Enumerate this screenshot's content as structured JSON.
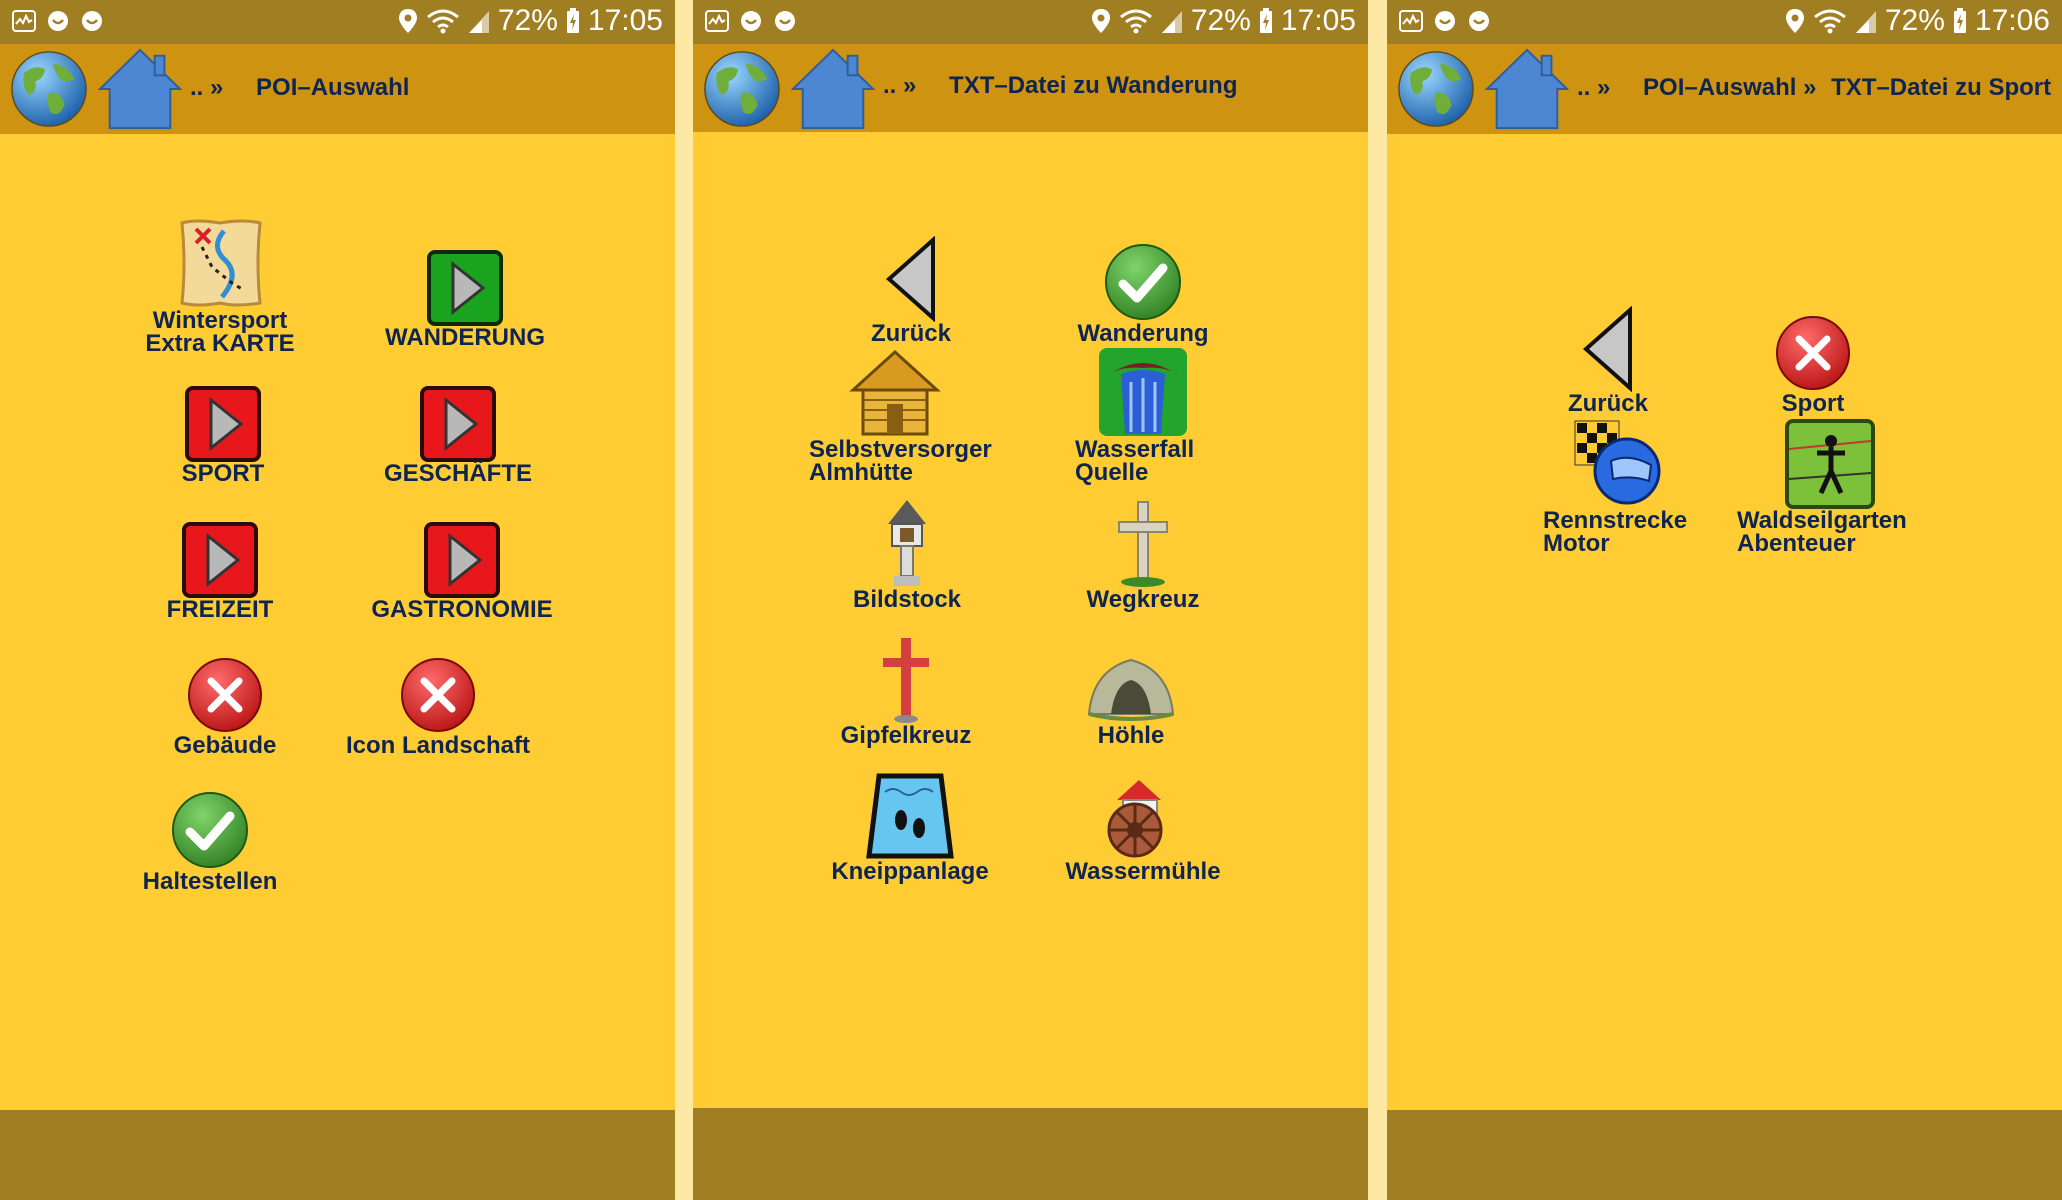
{
  "status": {
    "battery": "72%",
    "times": [
      "17:05",
      "17:05",
      "17:06"
    ]
  },
  "colors": {
    "background": "#ffcc33",
    "header": "#cf9312",
    "statusbar": "#a07e22",
    "text": "#0e2550"
  },
  "screens": [
    {
      "breadcrumb_prefix": ".. »",
      "title": "POI–Auswahl",
      "items": [
        {
          "label1": "Wintersport",
          "label2": "Extra KARTE",
          "icon": "map-icon"
        },
        {
          "label1": "WANDERUNG",
          "label2": "",
          "icon": "green-play-icon"
        },
        {
          "label1": "SPORT",
          "label2": "",
          "icon": "red-play-icon"
        },
        {
          "label1": "GESCHÄFTE",
          "label2": "",
          "icon": "red-play-icon"
        },
        {
          "label1": "FREIZEIT",
          "label2": "",
          "icon": "red-play-icon"
        },
        {
          "label1": "GASTRONOMIE",
          "label2": "",
          "icon": "red-play-icon"
        },
        {
          "label1": "Gebäude",
          "label2": "",
          "icon": "red-x-icon"
        },
        {
          "label1": "Icon Landschaft",
          "label2": "",
          "icon": "red-x-icon"
        },
        {
          "label1": "Haltestellen",
          "label2": "",
          "icon": "green-check-icon"
        }
      ]
    },
    {
      "breadcrumb_prefix": ".. »",
      "title": "TXT–Datei zu Wanderung",
      "items": [
        {
          "label1": "Zurück",
          "label2": "",
          "icon": "back-triangle-icon"
        },
        {
          "label1": "Wanderung",
          "label2": "",
          "icon": "green-check-icon"
        },
        {
          "label1": "Selbstversorger",
          "label2": "Almhütte",
          "icon": "log-cabin-icon"
        },
        {
          "label1": "Wasserfall",
          "label2": "Quelle",
          "icon": "waterfall-icon"
        },
        {
          "label1": "Bildstock",
          "label2": "",
          "icon": "wayside-shrine-icon"
        },
        {
          "label1": "Wegkreuz",
          "label2": "",
          "icon": "wayside-cross-icon"
        },
        {
          "label1": "Gipfelkreuz",
          "label2": "",
          "icon": "summit-cross-icon"
        },
        {
          "label1": "Höhle",
          "label2": "",
          "icon": "cave-icon"
        },
        {
          "label1": "Kneippanlage",
          "label2": "",
          "icon": "kneipp-pool-icon"
        },
        {
          "label1": "Wassermühle",
          "label2": "",
          "icon": "watermill-icon"
        }
      ]
    },
    {
      "breadcrumb_prefix": ".. »",
      "title": "POI–Auswahl »",
      "title2": "TXT–Datei zu Sport",
      "items": [
        {
          "label1": "Zurück",
          "label2": "",
          "icon": "back-triangle-icon"
        },
        {
          "label1": "Sport",
          "label2": "",
          "icon": "red-x-icon"
        },
        {
          "label1": "Rennstrecke",
          "label2": "Motor",
          "icon": "racetrack-icon"
        },
        {
          "label1": "Waldseilgarten",
          "label2": "Abenteuer",
          "icon": "rope-park-icon"
        }
      ]
    }
  ]
}
